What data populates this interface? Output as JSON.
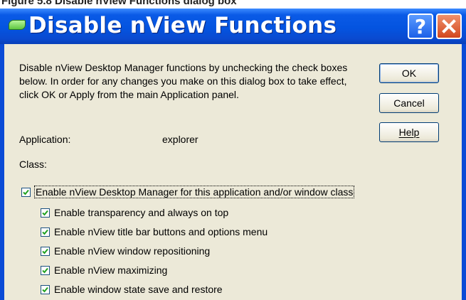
{
  "top_fragment": "Figure 5.8  Disable nView Functions dialog box",
  "dialog": {
    "title": "Disable nView Functions",
    "help_glyph": "?",
    "close_glyph": "✕",
    "description": "Disable nView Desktop Manager functions by unchecking the check boxes below. In order for any changes you make on this dialog box to take effect, click OK or Apply from the main Application panel.",
    "buttons": {
      "ok": "OK",
      "cancel": "Cancel",
      "help": "Help"
    },
    "application_label": "Application:",
    "application_value": "explorer",
    "class_label": "Class:",
    "main_checkbox": {
      "label": "Enable nView Desktop Manager for this application and/or window class",
      "checked": true
    },
    "options": [
      {
        "label": "Enable transparency and always on top",
        "checked": true
      },
      {
        "label": "Enable nView title bar buttons and options menu",
        "checked": true
      },
      {
        "label": "Enable nView window repositioning",
        "checked": true
      },
      {
        "label": "Enable nView maximizing",
        "checked": true
      },
      {
        "label": "Enable window state save and restore",
        "checked": true
      }
    ]
  },
  "colors": {
    "titlebar": "#0454e0",
    "dialog_face": "#ece9d8",
    "checkmark": "#21a121",
    "close_button": "#d2471e"
  },
  "icons": [
    "app-icon",
    "help-icon",
    "close-icon",
    "checkmark-icon"
  ]
}
